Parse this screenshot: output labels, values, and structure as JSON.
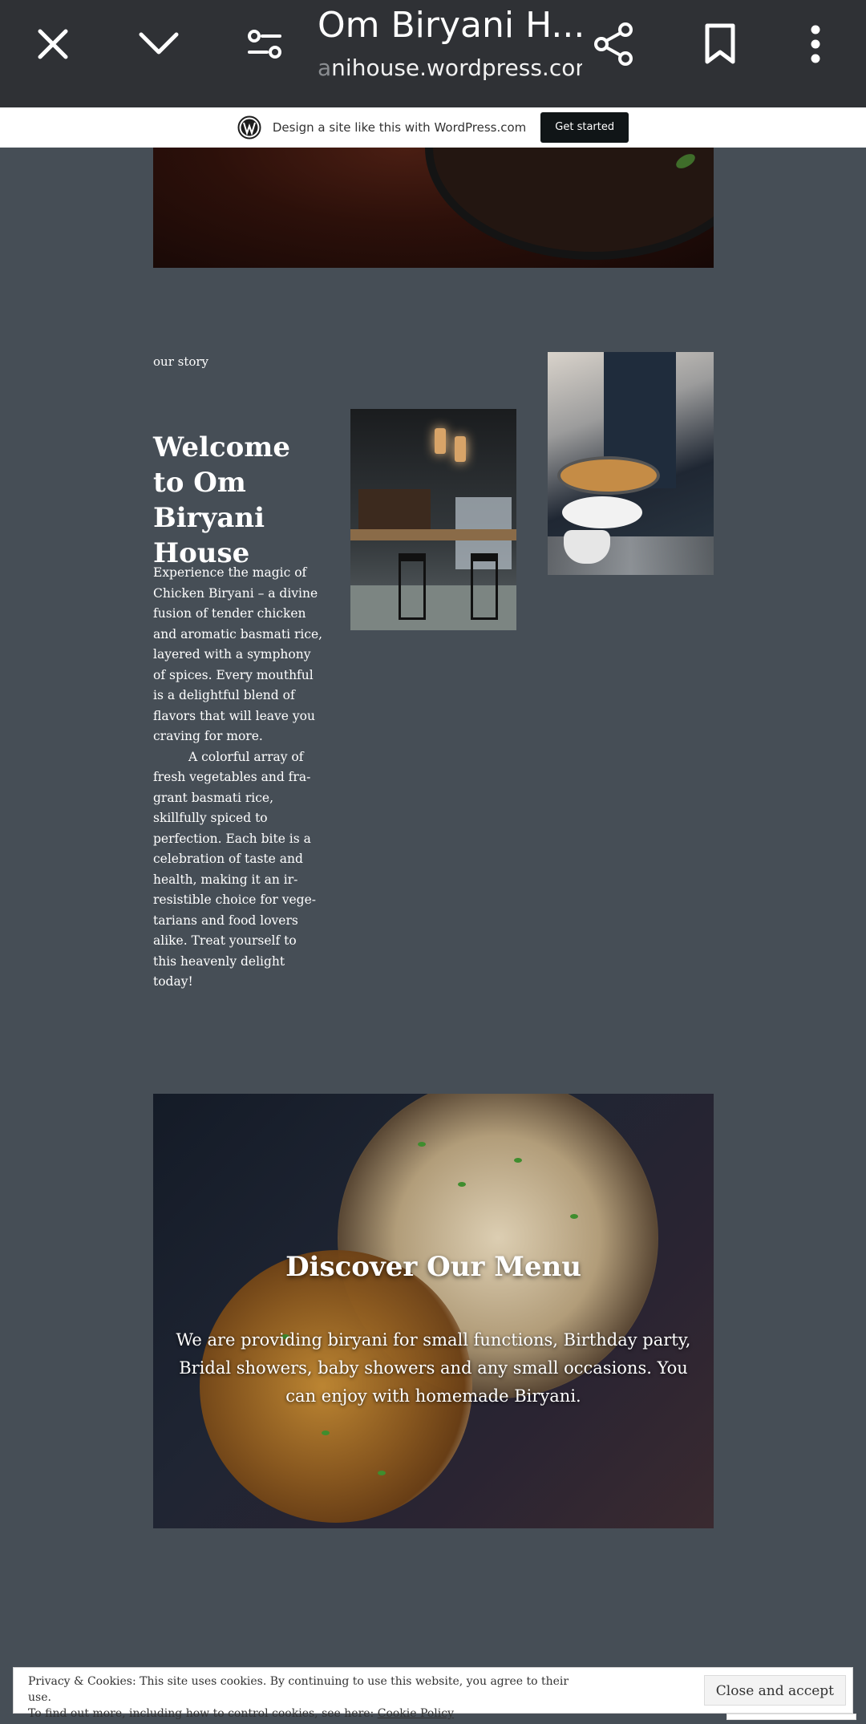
{
  "browser": {
    "title": "Om Biryani H...",
    "url_faded": "a",
    "url_main": "nihouse.wordpress.com",
    "icons": [
      "close-icon",
      "chevron-down-icon",
      "page-settings-icon",
      "share-icon",
      "bookmark-icon",
      "more-vert-icon"
    ]
  },
  "wp_banner": {
    "text": "Design a site like this with WordPress.com",
    "button": "Get started"
  },
  "story": {
    "eyebrow": "our story",
    "heading": "Welcome to Om Biryani House",
    "paragraph1": "Experience the magic of Chicken Biryani – a divine fusion of tender chicken and aromatic basmati rice, layered with a symphony of spices. Every mouthful is a delightful blend of flavors that will leave you craving for more.",
    "paragraph2": "A colorful array of fresh vegetables and fra-grant basmati rice, skillfully spiced to perfection. Each bite is a celebration of taste and health, making it an ir-resistible choice for vege-tarians and food lovers alike. Treat yourself to this heavenly delight today!"
  },
  "menu": {
    "heading": "Discover Our Menu",
    "description": "We are providing biryani for small functions, Birthday party, Bridal showers, baby showers and any small occasions. You can enjoy with homemade Biryani."
  },
  "cookie": {
    "line1": "Privacy & Cookies: This site uses cookies. By continuing to use this website, you agree to their use.",
    "line2_prefix": "To find out more, including how to control cookies, see here:",
    "link": "Cookie Policy",
    "button": "Close and accept"
  },
  "colors": {
    "page_background": "#464e56",
    "browser_bar": "#2f3135",
    "wp_button": "#101517"
  }
}
